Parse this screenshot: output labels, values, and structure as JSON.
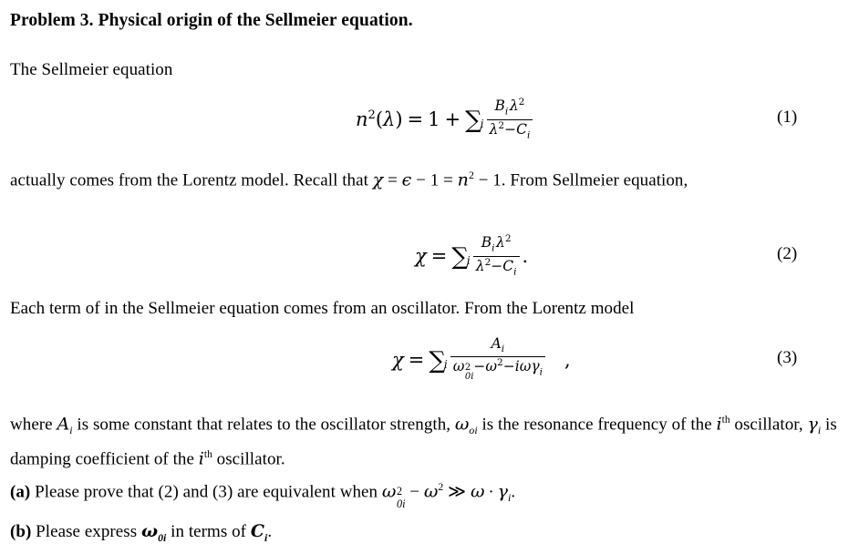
{
  "document": {
    "title": "Problem 3. Physical origin of the Sellmeier equation.",
    "intro": "The Sellmeier equation",
    "paragraph_after_eq1": {
      "lead": "actually comes from the Lorentz model. Recall that ",
      "chi": "χ",
      "eq_mid": " = ",
      "epsilon": "ϵ",
      "minus_one": " − 1 = ",
      "n": "n",
      "n_sup": "2",
      "tail": " − 1. From Sellmeier equation,"
    },
    "paragraph_each_term": "Each term of in the Sellmeier equation comes from an oscillator. From the Lorentz model",
    "paragraph_where": {
      "lead": "where ",
      "A": "A",
      "A_sub": "i",
      "mid1": " is some constant that relates to the oscillator strength, ",
      "omega": "ω",
      "omega_sub": "oi",
      "mid2": " is the resonance frequency of the ",
      "i1": "i",
      "th1": "th",
      "mid3": " oscillator, ",
      "gamma": "γ",
      "gamma_sub": "i",
      "mid4": " is damping coefficient of the ",
      "i2": "i",
      "th2": "th",
      "tail": " oscillator."
    },
    "part_a": {
      "label": "(a)",
      "lead": " Please prove that (2) and (3) are equivalent when ",
      "omega": "ω",
      "omega_sup": "2",
      "omega_sub": "0i",
      "minus": " − ",
      "omega2": "ω",
      "omega2_sup": "2",
      "gg": "≫",
      "omega3": "ω",
      "cdot": "·",
      "gamma": "γ",
      "gamma_sub": "i",
      "tail": "."
    },
    "part_b": {
      "label": "(b)",
      "lead": " Please express ",
      "omega": "ω",
      "omega_sub": "0i",
      "mid": " in terms of ",
      "C": "C",
      "C_sub": "i",
      "tail": "."
    }
  },
  "equations": {
    "eq1": {
      "number": "(1)",
      "lhs_n": "n",
      "lhs_sup": "2",
      "lhs_paren_open": "(",
      "lhs_lambda": "λ",
      "lhs_paren_close": ")",
      "equals": "=",
      "one": "1",
      "plus": "+",
      "sigma": "∑",
      "sigma_sub": "i",
      "num_B": "B",
      "num_B_sub": "i",
      "num_lambda": "λ",
      "num_lambda_sup": "2",
      "den_lambda": "λ",
      "den_lambda_sup": "2",
      "den_minus": "−",
      "den_C": "C",
      "den_C_sub": "i",
      "trailing": ""
    },
    "eq2": {
      "number": "(2)",
      "lhs_chi": "χ",
      "equals": "=",
      "sigma": "∑",
      "sigma_sub": "i",
      "num_B": "B",
      "num_B_sub": "i",
      "num_lambda": "λ",
      "num_lambda_sup": "2",
      "den_lambda": "λ",
      "den_lambda_sup": "2",
      "den_minus": "−",
      "den_C": "C",
      "den_C_sub": "i",
      "trailing": "."
    },
    "eq3": {
      "number": "(3)",
      "lhs_chi": "χ",
      "equals": "=",
      "sigma": "∑",
      "sigma_sub": "i",
      "num_A": "A",
      "num_A_sub": "i",
      "den_omega": "ω",
      "den_omega_sup": "2",
      "den_omega_sub": "0i",
      "den_minus1": "−",
      "den_omega2": "ω",
      "den_omega2_sup": "2",
      "den_minus2": "−",
      "den_i": "i",
      "den_omega3": "ω",
      "den_gamma": "γ",
      "den_gamma_sub": "i",
      "trailing": ","
    }
  },
  "colors": {
    "text": "#000000",
    "background": "#ffffff"
  }
}
